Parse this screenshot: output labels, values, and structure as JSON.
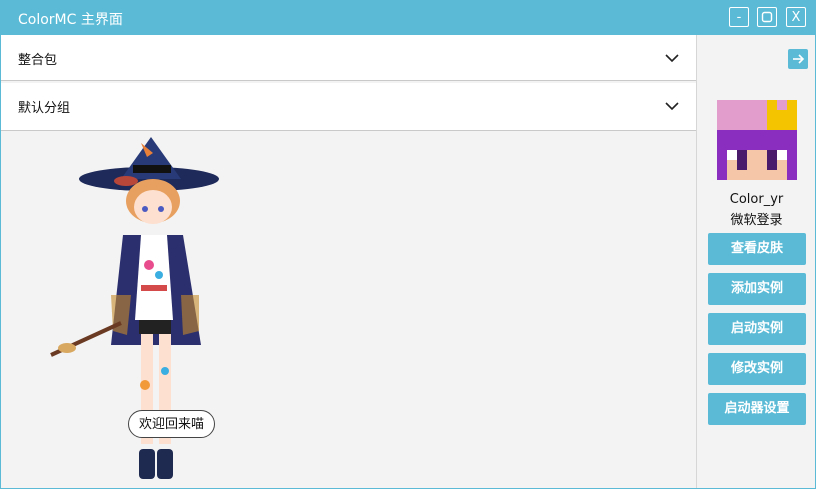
{
  "window": {
    "title": "ColorMC 主界面",
    "controls": {
      "minimize": "-",
      "maximize": "□",
      "close": "X"
    }
  },
  "groups": [
    {
      "label": "整合包"
    },
    {
      "label": "默认分组"
    }
  ],
  "welcome_text": "欢迎回来喵",
  "user": {
    "name": "Color_yr",
    "login_type": "微软登录"
  },
  "actions": [
    {
      "label": "查看皮肤"
    },
    {
      "label": "添加实例"
    },
    {
      "label": "启动实例"
    },
    {
      "label": "修改实例"
    },
    {
      "label": "启动器设置"
    }
  ],
  "colors": {
    "accent": "#5bbbd6",
    "background": "#f3f3f3"
  },
  "icons": {
    "collapse": "arrow-right-icon",
    "expand": "chevron-down-icon"
  }
}
